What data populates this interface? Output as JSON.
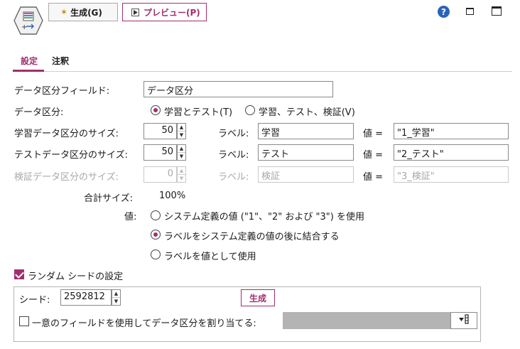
{
  "toolbar": {
    "generate_label": "生成(G)",
    "preview_label": "プレビュー(P)"
  },
  "window": {
    "help_icon": "?"
  },
  "tabs": [
    {
      "label": "設定",
      "active": true
    },
    {
      "label": "注釈",
      "active": false
    }
  ],
  "partition_field": {
    "label": "データ区分フィールド:",
    "value": "データ区分"
  },
  "partitions": {
    "label": "データ区分:",
    "options": [
      {
        "label": "学習とテスト(T)",
        "selected": true
      },
      {
        "label": "学習、テスト、検証(V)",
        "selected": false
      }
    ]
  },
  "rows": [
    {
      "size_label": "学習データ区分のサイズ:",
      "size": "50",
      "label_label": "ラベル:",
      "label_value": "学習",
      "value_label": "値 =",
      "value": "\"1_学習\"",
      "enabled": true
    },
    {
      "size_label": "テストデータ区分のサイズ:",
      "size": "50",
      "label_label": "ラベル:",
      "label_value": "テスト",
      "value_label": "値 =",
      "value": "\"2_テスト\"",
      "enabled": true
    },
    {
      "size_label": "検証データ区分のサイズ:",
      "size": "0",
      "label_label": "ラベル:",
      "label_value": "検証",
      "value_label": "値 =",
      "value": "\"3_検証\"",
      "enabled": false
    }
  ],
  "total": {
    "label": "合計サイズ:",
    "value": "100%"
  },
  "values": {
    "label": "値:",
    "options": [
      {
        "label": "システム定義の値 (\"1\"、\"2\" および \"3\") を使用",
        "selected": false
      },
      {
        "label": "ラベルをシステム定義の値の後に結合する",
        "selected": true
      },
      {
        "label": "ラベルを値として使用",
        "selected": false
      }
    ]
  },
  "random_seed": {
    "checkbox_label": "ランダム シードの設定",
    "checked": true,
    "seed_label": "シード:",
    "seed_value": "2592812",
    "generate_label": "生成"
  },
  "unique_field": {
    "checkbox_label": "一意のフィールドを使用してデータ区分を割り当てる:",
    "checked": false,
    "value": ""
  },
  "colors": {
    "accent": "#a12f6e",
    "help": "#2a64b8",
    "disabled_text": "#a8a8a8"
  }
}
